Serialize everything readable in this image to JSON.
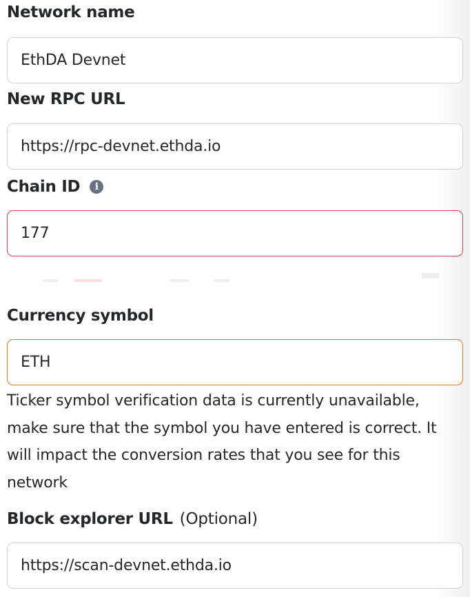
{
  "network_name": {
    "label": "Network name",
    "value": "EthDA Devnet"
  },
  "rpc_url": {
    "label": "New RPC URL",
    "value": "https://rpc-devnet.ethda.io"
  },
  "chain_id": {
    "label": "Chain ID",
    "info_icon": "info-icon",
    "info_glyph": "i",
    "value": "177",
    "state": "error",
    "border_color": "#d73a49"
  },
  "currency_symbol": {
    "label": "Currency symbol",
    "value": "ETH",
    "state": "warning",
    "border_color": "#e2761b",
    "help_text": "Ticker symbol verification data is currently unavailable, make sure that the symbol you have entered is correct. It will impact the conversion rates that you see for this network"
  },
  "block_explorer": {
    "label": "Block explorer URL",
    "optional_label": "(Optional)",
    "value": "https://scan-devnet.ethda.io"
  }
}
